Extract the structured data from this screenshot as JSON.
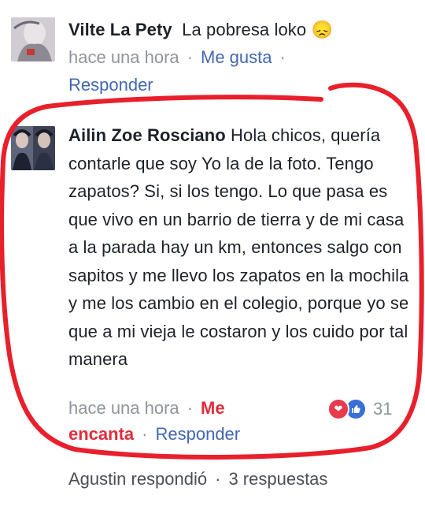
{
  "comment1": {
    "author": "Vilte La Pety",
    "text": "La pobresa loko",
    "emoji": "😞",
    "time": "hace una hora",
    "separator": "·",
    "like_label": "Me gusta",
    "reply_label": "Responder"
  },
  "comment2": {
    "author": "Ailin Zoe Rosciano",
    "text": "Hola chicos, quería contarle que soy Yo la de la foto. Tengo zapatos? Si, si los tengo. Lo que pasa es que vivo en un barrio de tierra y de mi casa a la parada hay un km, entonces salgo con sapitos y me llevo los zapatos en la mochila y me los cambio en el colegio, porque yo se que a mi vieja le costaron y los cuido por tal manera",
    "time": "hace una hora",
    "separator": "·",
    "reaction_label_line1": "Me",
    "reaction_label_line2": "encanta",
    "reply_label": "Responder",
    "reaction_count": "31",
    "reaction_icons": [
      "heart-icon",
      "thumbs-up-icon"
    ]
  },
  "replies_summary": {
    "replier": "Agustin respondió",
    "separator": "·",
    "count_label": "3 respuestas"
  },
  "colors": {
    "link": "#4267b2",
    "love": "#e02c3b",
    "meta": "#90949c",
    "highlight_stroke": "#e8202c"
  }
}
